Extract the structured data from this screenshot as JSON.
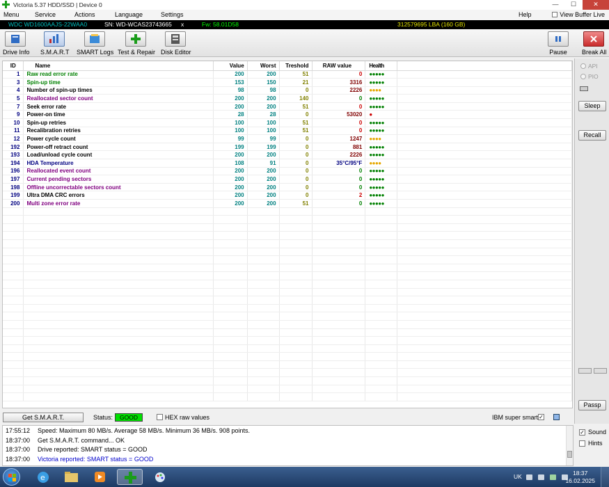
{
  "window": {
    "title": "Victoria 5.37 HDD/SSD | Device 0",
    "controls": {
      "minimize": "—",
      "maximize": "☐",
      "close": "✕"
    }
  },
  "menu": {
    "items": [
      "Menu",
      "Service",
      "Actions",
      "Language",
      "Settings",
      "Help"
    ],
    "view_buffer_live": "View Buffer Live"
  },
  "device_info": {
    "model": "WDC WD1600AAJS-22WAA0",
    "serial": "SN: WD-WCAS23743665",
    "close_glyph": "x",
    "firmware": "Fw: 58.01D58",
    "capacity": "312579695 LBA (160 GB)"
  },
  "toolbar": {
    "drive_info": "Drive Info",
    "smart": "S.M.A.R.T",
    "smart_logs": "SMART Logs",
    "test_repair": "Test & Repair",
    "disk_editor": "Disk Editor",
    "pause": "Pause",
    "break_all": "Break All"
  },
  "smart_table": {
    "headers": {
      "id": "ID",
      "name": "Name",
      "value": "Value",
      "worst": "Worst",
      "treshold": "Treshold",
      "raw": "RAW value",
      "health": "Health"
    },
    "rows": [
      {
        "id": "1",
        "name": "Raw read error rate",
        "value": "200",
        "worst": "200",
        "treshold": "51",
        "raw": "0",
        "health": "●●●●●",
        "health_color": "#008000",
        "name_color": "#008000",
        "raw_color": "#cc0000"
      },
      {
        "id": "3",
        "name": "Spin-up time",
        "value": "153",
        "worst": "150",
        "treshold": "21",
        "raw": "3316",
        "health": "●●●●●",
        "health_color": "#008000",
        "name_color": "#008000",
        "raw_color": "#800000"
      },
      {
        "id": "4",
        "name": "Number of spin-up times",
        "value": "98",
        "worst": "98",
        "treshold": "0",
        "raw": "2226",
        "health": "●●●●",
        "health_color": "#e6a800",
        "name_color": "#000000",
        "raw_color": "#800000"
      },
      {
        "id": "5",
        "name": "Reallocated sector count",
        "value": "200",
        "worst": "200",
        "treshold": "140",
        "raw": "0",
        "health": "●●●●●",
        "health_color": "#008000",
        "name_color": "#800080",
        "raw_color": "#008000"
      },
      {
        "id": "7",
        "name": "Seek error rate",
        "value": "200",
        "worst": "200",
        "treshold": "51",
        "raw": "0",
        "health": "●●●●●",
        "health_color": "#008000",
        "name_color": "#000000",
        "raw_color": "#cc0000"
      },
      {
        "id": "9",
        "name": "Power-on time",
        "value": "28",
        "worst": "28",
        "treshold": "0",
        "raw": "53020",
        "health": "●",
        "health_color": "#cc0000",
        "name_color": "#000000",
        "raw_color": "#800000"
      },
      {
        "id": "10",
        "name": "Spin-up retries",
        "value": "100",
        "worst": "100",
        "treshold": "51",
        "raw": "0",
        "health": "●●●●●",
        "health_color": "#008000",
        "name_color": "#000000",
        "raw_color": "#cc0000"
      },
      {
        "id": "11",
        "name": "Recalibration retries",
        "value": "100",
        "worst": "100",
        "treshold": "51",
        "raw": "0",
        "health": "●●●●●",
        "health_color": "#008000",
        "name_color": "#000000",
        "raw_color": "#cc0000"
      },
      {
        "id": "12",
        "name": "Power cycle count",
        "value": "99",
        "worst": "99",
        "treshold": "0",
        "raw": "1247",
        "health": "●●●●",
        "health_color": "#e6a800",
        "name_color": "#000000",
        "raw_color": "#800000"
      },
      {
        "id": "192",
        "name": "Power-off retract count",
        "value": "199",
        "worst": "199",
        "treshold": "0",
        "raw": "881",
        "health": "●●●●●",
        "health_color": "#008000",
        "name_color": "#000000",
        "raw_color": "#800000"
      },
      {
        "id": "193",
        "name": "Load/unload cycle count",
        "value": "200",
        "worst": "200",
        "treshold": "0",
        "raw": "2226",
        "health": "●●●●●",
        "health_color": "#008000",
        "name_color": "#000000",
        "raw_color": "#800000"
      },
      {
        "id": "194",
        "name": "HDA Temperature",
        "value": "108",
        "worst": "91",
        "treshold": "0",
        "raw": "35°C/95°F",
        "health": "●●●●",
        "health_color": "#e6a800",
        "name_color": "#000080",
        "raw_color": "#000080"
      },
      {
        "id": "196",
        "name": "Reallocated event count",
        "value": "200",
        "worst": "200",
        "treshold": "0",
        "raw": "0",
        "health": "●●●●●",
        "health_color": "#008000",
        "name_color": "#800080",
        "raw_color": "#008000"
      },
      {
        "id": "197",
        "name": "Current pending sectors",
        "value": "200",
        "worst": "200",
        "treshold": "0",
        "raw": "0",
        "health": "●●●●●",
        "health_color": "#008000",
        "name_color": "#800080",
        "raw_color": "#008000"
      },
      {
        "id": "198",
        "name": "Offline uncorrectable sectors count",
        "value": "200",
        "worst": "200",
        "treshold": "0",
        "raw": "0",
        "health": "●●●●●",
        "health_color": "#008000",
        "name_color": "#800080",
        "raw_color": "#008000"
      },
      {
        "id": "199",
        "name": "Ultra DMA CRC errors",
        "value": "200",
        "worst": "200",
        "treshold": "0",
        "raw": "2",
        "health": "●●●●●",
        "health_color": "#008000",
        "name_color": "#000000",
        "raw_color": "#cc0000"
      },
      {
        "id": "200",
        "name": "Multi zone error rate",
        "value": "200",
        "worst": "200",
        "treshold": "51",
        "raw": "0",
        "health": "●●●●●",
        "health_color": "#008000",
        "name_color": "#800080",
        "raw_color": "#008000"
      }
    ]
  },
  "right_panel": {
    "api_label": "API",
    "pio_label": "PIO",
    "sleep": "Sleep",
    "recall": "Recall",
    "passp": "Passp"
  },
  "status_bar": {
    "get_smart": "Get S.M.A.R.T.",
    "status_label": "Status:",
    "status_value": "GOOD",
    "hex_raw": "HEX raw values",
    "ibm_super_smart": "IBM super smart:",
    "check_glyph": "✓"
  },
  "log": [
    {
      "time": "17:55:12",
      "message": "Speed: Maximum 80 MB/s. Average 58 MB/s. Minimum 36 MB/s. 908 points.",
      "color": "#000000"
    },
    {
      "time": "18:37:00",
      "message": "Get S.M.A.R.T. command... OK",
      "color": "#000000"
    },
    {
      "time": "18:37:00",
      "message": "Drive reported: SMART status = GOOD",
      "color": "#000000"
    },
    {
      "time": "18:37:00",
      "message": "Victoria reported: SMART status = GOOD",
      "color": "#0000cc"
    }
  ],
  "sound_panel": {
    "sound": "Sound",
    "hints": "Hints",
    "check_glyph": "✓"
  },
  "taskbar": {
    "language": "UK",
    "time": "18:37",
    "date": "16.02.2025"
  },
  "colors": {
    "value_teal": "#008080",
    "treshold_olive": "#808000",
    "status_good": "#00e000",
    "infobar_cyan": "#00c0c0",
    "infobar_green": "#00ff00",
    "infobar_yellow": "#e6e600"
  }
}
